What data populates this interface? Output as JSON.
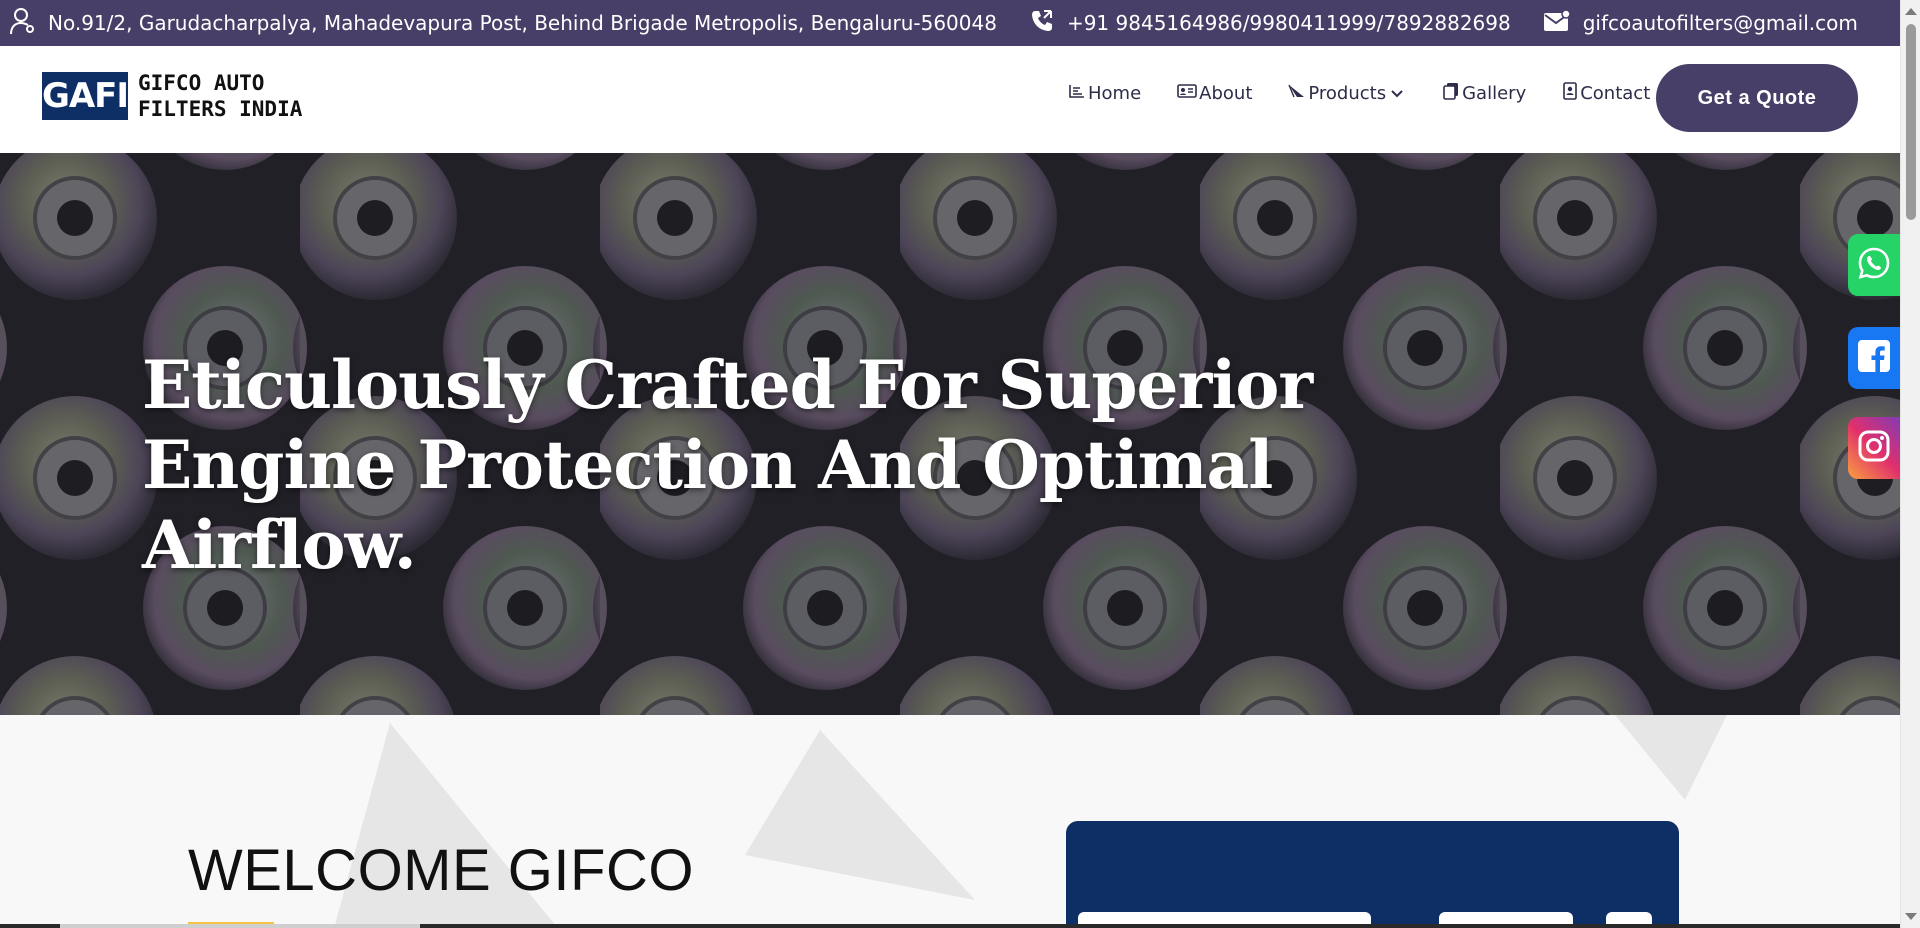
{
  "topbar": {
    "address": "No.91/2, Garudacharpalya, Mahadevapura Post, Behind Brigade Metropolis, Bengaluru-560048",
    "phone": "+91 9845164986/9980411999/7892882698",
    "email": "gifcoautofilters@gmail.com",
    "address_icon": "person-location-icon",
    "phone_icon": "phone-icon",
    "email_icon": "envelope-icon"
  },
  "header": {
    "logo_mark": "GAFI",
    "logo_line1": "GIFCO AUTO",
    "logo_line2": "FILTERS INDIA",
    "nav": [
      {
        "label": "Home",
        "icon": "home-list-icon"
      },
      {
        "label": "About",
        "icon": "id-card-icon"
      },
      {
        "label": "Products",
        "icon": "paper-plane-icon",
        "dropdown": true
      },
      {
        "label": "Gallery",
        "icon": "copy-icon"
      },
      {
        "label": "Contact",
        "icon": "contact-book-icon"
      }
    ],
    "cta_label": "Get a Quote"
  },
  "hero": {
    "title": "Eticulously Crafted For Superior Engine Protection And Optimal Airflow."
  },
  "social": [
    "whatsapp-icon",
    "facebook-icon",
    "instagram-icon"
  ],
  "welcome": {
    "title": "WELCOME GIFCO"
  },
  "colors": {
    "brand_purple": "#473f67",
    "logo_blue": "#0d2f66",
    "accent_yellow": "#f5c443",
    "whatsapp": "#25d366",
    "facebook": "#1877f2"
  }
}
